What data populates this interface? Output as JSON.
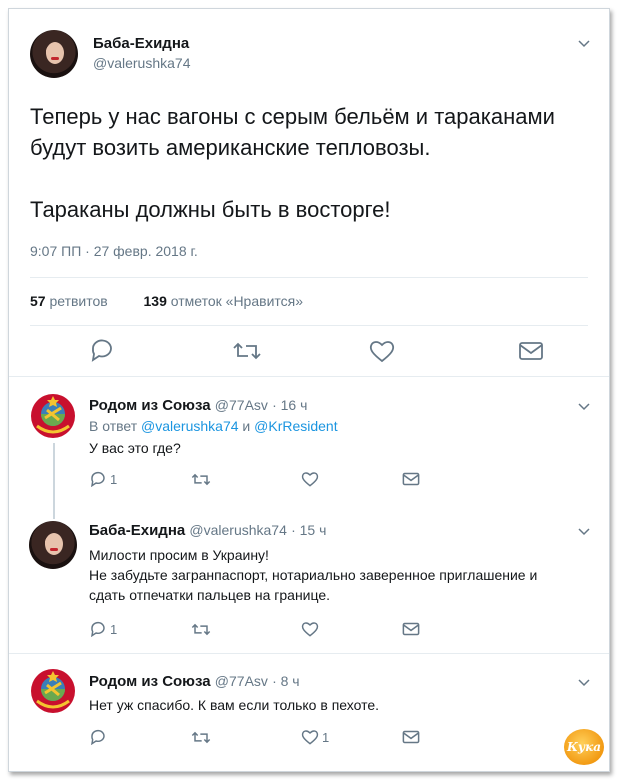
{
  "main_tweet": {
    "author_name": "Баба-Ехидна",
    "author_handle": "@valerushka74",
    "text_line1": "Теперь у нас вагоны с серым бельём и тараканами будут возить американские тепловозы.",
    "text_line2": "Тараканы должны быть в восторге!",
    "timestamp": "9:07 ПП · 27 февр. 2018 г.",
    "retweets_count": "57",
    "retweets_label": "ретвитов",
    "likes_count": "139",
    "likes_label": "отметок «Нравится»"
  },
  "replies": [
    {
      "author_name": "Родом из Союза",
      "author_handle": "@77Asv",
      "time": "· 16 ч",
      "reply_to_prefix": "В ответ",
      "reply_to_user1": "@valerushka74",
      "reply_to_and": "и",
      "reply_to_user2": "@KrResident",
      "text": "У вас это где?",
      "reply_count": "1",
      "like_count": ""
    },
    {
      "author_name": "Баба-Ехидна",
      "author_handle": "@valerushka74",
      "time": "· 15 ч",
      "text_line1": "Милости просим в Украину!",
      "text_line2": "Не забудьте загранпаспорт, нотариально заверенное приглашение и сдать отпечатки пальцев на границе.",
      "reply_count": "1",
      "like_count": ""
    },
    {
      "author_name": "Родом из Союза",
      "author_handle": "@77Asv",
      "time": "· 8 ч",
      "text": "Нет уж спасибо. К вам если только в пехоте.",
      "reply_count": "",
      "like_count": "1"
    }
  ],
  "watermark": "Кука",
  "icons": [
    "reply-icon",
    "retweet-icon",
    "like-icon",
    "dm-icon",
    "chevron-down-icon"
  ],
  "colors": {
    "link": "#1b95e0",
    "muted": "#657786",
    "text": "#14171a",
    "divider": "#e6ecf0"
  }
}
